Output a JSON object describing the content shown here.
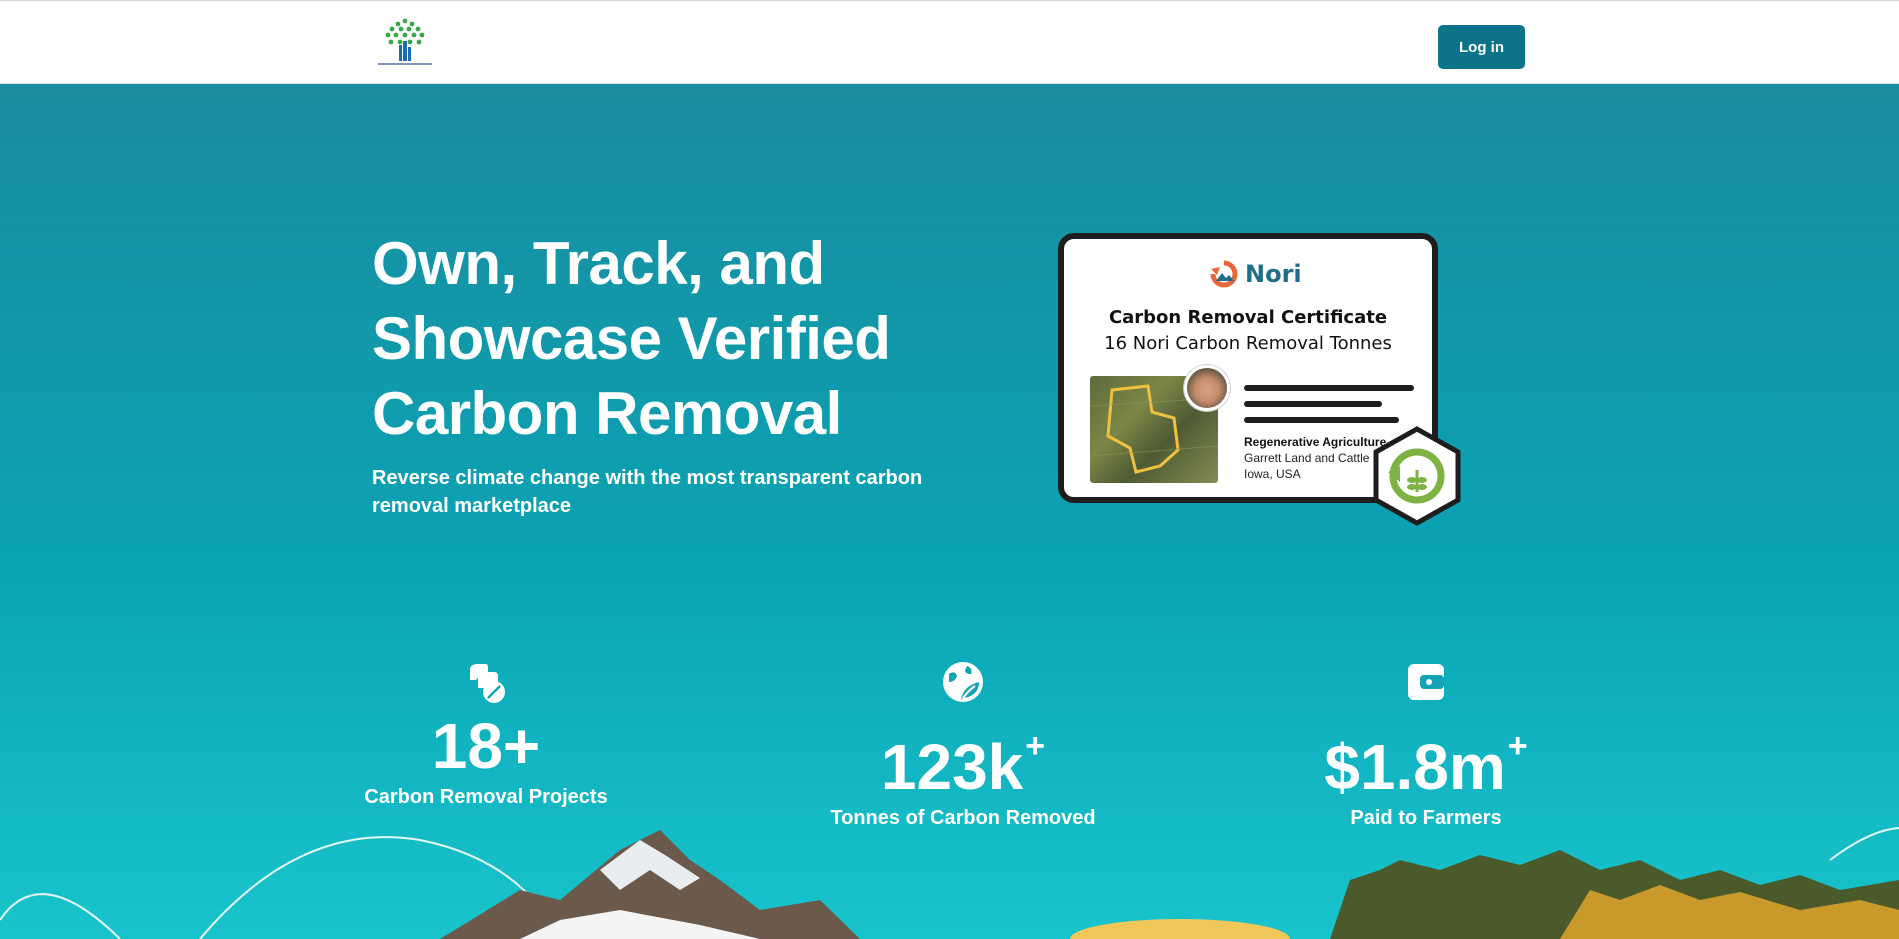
{
  "header": {
    "login_label": "Log in"
  },
  "hero": {
    "title": "Own, Track, and Showcase Verified Carbon Removal",
    "subtitle": "Reverse climate change with the most transparent carbon removal marketplace"
  },
  "certificate": {
    "brand": "Nori",
    "title": "Carbon Removal Certificate",
    "tonnes": "16 Nori Carbon Removal Tonnes",
    "category": "Regenerative Agriculture",
    "owner": "Garrett Land and Cattle",
    "location": "Iowa, USA"
  },
  "stats": [
    {
      "icon": "leaves-icon",
      "value": "18+",
      "suffix": "",
      "label": "Carbon Removal Projects"
    },
    {
      "icon": "earth-leaf-icon",
      "value": "123k",
      "suffix": "+",
      "label": "Tonnes of Carbon Removed"
    },
    {
      "icon": "wallet-icon",
      "value": "$1.8m",
      "suffix": "+",
      "label": "Paid to Farmers"
    }
  ],
  "colors": {
    "accent": "#0c7489",
    "hero_top": "#1a8c9e",
    "hero_bottom": "#18c4cc",
    "brand_orange": "#e8663a",
    "brand_blue": "#1f6f8b"
  }
}
